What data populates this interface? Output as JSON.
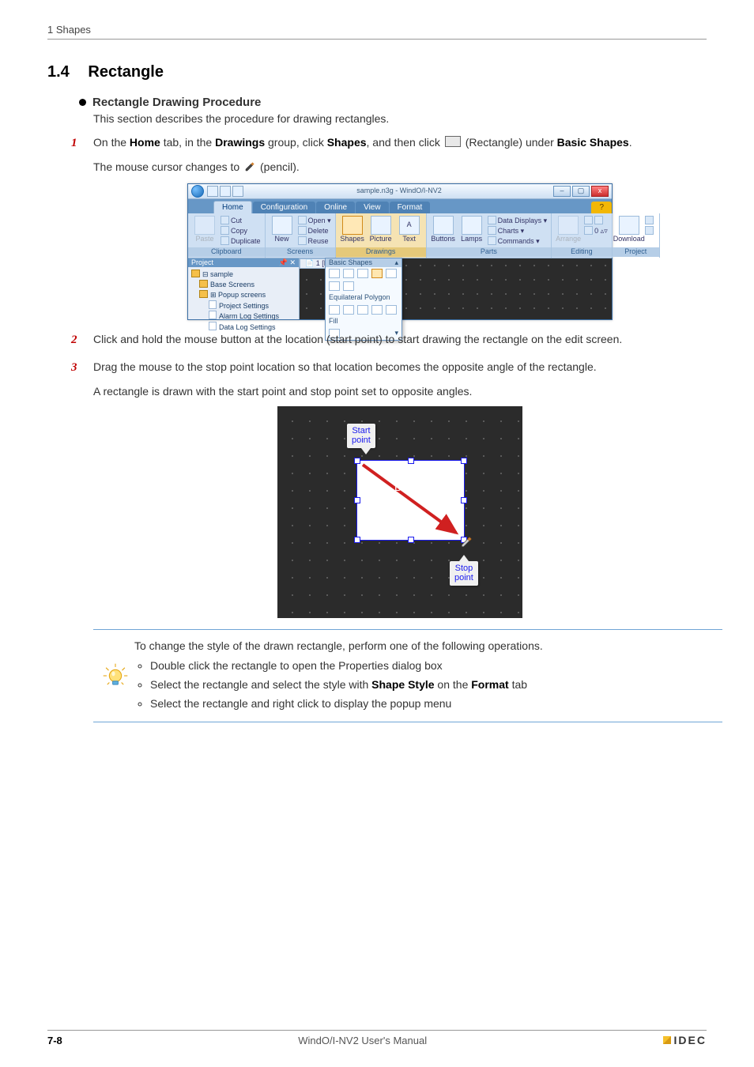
{
  "running_header": "1 Shapes",
  "section": {
    "number": "1.4",
    "title": "Rectangle"
  },
  "sub": {
    "heading": "Rectangle Drawing Procedure",
    "desc": "This section describes the procedure for drawing rectangles."
  },
  "steps": {
    "s1_pre": "On the ",
    "s1_tab_label": "Home",
    "s1_mid1": " tab, in the ",
    "s1_group_label": "Drawings",
    "s1_mid2": " group, click ",
    "s1_btn_label": "Shapes",
    "s1_mid3": ", and then click ",
    "s1_shape_hint": " (Rectangle) under ",
    "s1_category_label": "Basic Shapes",
    "s1_end": ".",
    "s1_extra_pre": "The mouse cursor changes to ",
    "s1_extra_post": " (pencil).",
    "s2": "Click and hold the mouse button at the location (start point) to start drawing the rectangle on the edit screen.",
    "s3_a": "Drag the mouse to the stop point location so that location becomes the opposite angle of the rectangle.",
    "s3_b": "A rectangle is drawn with the start point and stop point set to opposite angles."
  },
  "app": {
    "title": "sample.n3g - WindO/I-NV2",
    "tabs": [
      "Home",
      "Configuration",
      "Online",
      "View",
      "Format"
    ],
    "groups": {
      "clipboard": {
        "label": "Clipboard",
        "paste": "Paste",
        "items": [
          "Cut",
          "Copy",
          "Duplicate"
        ]
      },
      "screens": {
        "label": "Screens",
        "new": "New",
        "items": [
          "Open",
          "Delete",
          "Reuse"
        ]
      },
      "drawings": {
        "label": "Drawings",
        "shapes": "Shapes",
        "picture": "Picture",
        "text": "Text"
      },
      "parts": {
        "label": "Parts",
        "buttons": "Buttons",
        "lamps": "Lamps",
        "items": [
          "Data Displays",
          "Charts",
          "Commands"
        ]
      },
      "editing": {
        "label": "Editing",
        "arrange": "Arrange",
        "zoom_value": "0"
      },
      "project": {
        "label": "Project",
        "download": "Download"
      }
    },
    "project_panel": {
      "title": "Project",
      "root": "sample",
      "nodes": [
        "Base Screens",
        "Popup screens",
        "Project Settings",
        "Alarm Log Settings",
        "Data Log Settings"
      ]
    },
    "doc_tab": "1 [Base",
    "shapes_dd": {
      "header": "Basic Shapes",
      "eq_poly": "Equilateral Polygon",
      "fill": "Fill"
    }
  },
  "diagram": {
    "start_label_l1": "Start",
    "start_label_l2": "point",
    "drag_label": "Drag",
    "stop_label_l1": "Stop",
    "stop_label_l2": "point"
  },
  "tip": {
    "intro": "To change the style of the drawn rectangle, perform one of the following operations.",
    "items_pre_3_mid_bold1": "Shape Style",
    "items_pre_3_mid_text": " on the ",
    "items_pre_3_mid_bold2": "Format",
    "items": [
      "Double click the rectangle to open the Properties dialog box",
      "Select the rectangle and select the style with ",
      " tab",
      "Select the rectangle and right click to display the popup menu"
    ]
  },
  "footer": {
    "page": "7-8",
    "manual": "WindO/I-NV2 User's Manual",
    "logo": "IDEC"
  }
}
